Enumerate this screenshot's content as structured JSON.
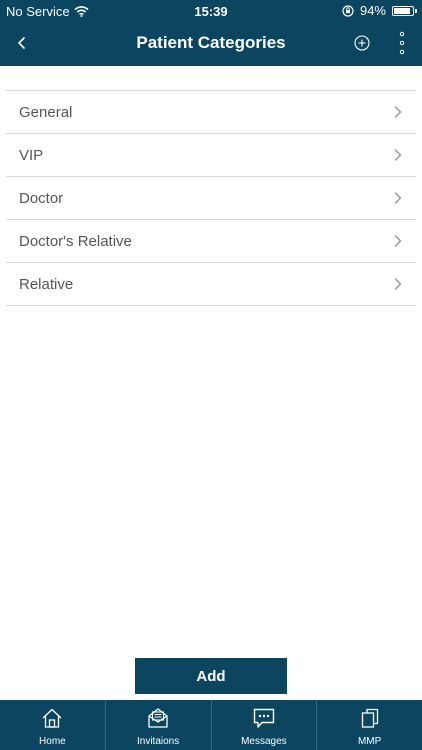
{
  "status_bar": {
    "carrier": "No Service",
    "time": "15:39",
    "battery": "94%",
    "battery_level": 0.94,
    "icons": [
      "wifi-icon",
      "orientation-lock-icon",
      "battery-icon"
    ]
  },
  "nav": {
    "title": "Patient Categories",
    "icons": [
      "back-chevron-icon",
      "add-circle-icon",
      "more-vertical-icon"
    ]
  },
  "categories": [
    {
      "label": "General"
    },
    {
      "label": "VIP"
    },
    {
      "label": "Doctor"
    },
    {
      "label": "Doctor's Relative"
    },
    {
      "label": "Relative"
    }
  ],
  "add_button": {
    "label": "Add"
  },
  "tabs": [
    {
      "label": "Home",
      "icon": "home-icon"
    },
    {
      "label": "Invitaions",
      "icon": "invitation-envelope-icon"
    },
    {
      "label": "Messages",
      "icon": "message-bubble-icon"
    },
    {
      "label": "MMP",
      "icon": "document-icon"
    }
  ],
  "colors": {
    "primary": "#0b4560",
    "divider": "#d7d7d7",
    "item_text": "#555555",
    "chevron": "#999999"
  }
}
